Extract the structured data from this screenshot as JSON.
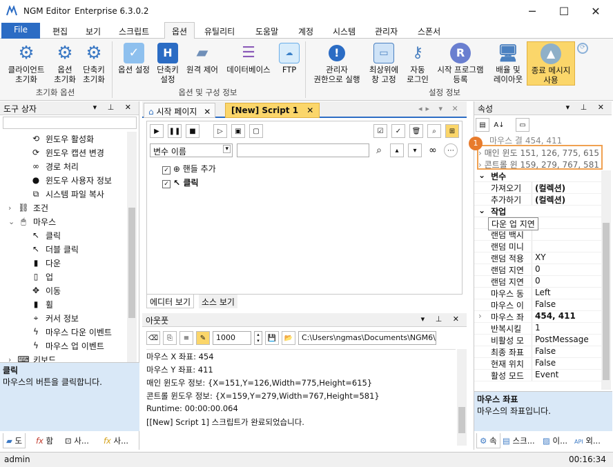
{
  "app": {
    "title": "NGM Editor",
    "version": "Enterprise 6.3.0.2"
  },
  "window_controls": {
    "minimize": "─",
    "maximize": "☐",
    "close": "✕"
  },
  "ribbon_tabs": [
    "File",
    "편집",
    "보기",
    "스크립트",
    "옵션",
    "유틸리티",
    "도움말",
    "계정",
    "시스템",
    "관리자",
    "스폰서"
  ],
  "ribbon_active_tab": "옵션",
  "ribbon": {
    "groups": [
      {
        "label": "초기화 옵션",
        "buttons": [
          {
            "label1": "클라이언트",
            "label2": "초기화",
            "icon": "gear-icon",
            "color": "#3a78c4"
          },
          {
            "label1": "옵션",
            "label2": "초기화",
            "icon": "gear-icon",
            "color": "#3a78c4"
          },
          {
            "label1": "단축키",
            "label2": "초기화",
            "icon": "gear-icon",
            "color": "#3a78c4"
          }
        ]
      },
      {
        "label": "옵션 및 구성 정보",
        "buttons": [
          {
            "label1": "옵션 설정",
            "label2": "",
            "icon": "checkbox-icon",
            "color": "#4a90d9"
          },
          {
            "label1": "단축키",
            "label2": "설정",
            "icon": "hotkey-icon",
            "color": "#2b6cc4"
          },
          {
            "label1": "원격 제어",
            "label2": "",
            "icon": "remote-icon",
            "color": "#6f8fb8"
          },
          {
            "label1": "데이터베이스",
            "label2": "",
            "icon": "database-icon",
            "color": "#8a5ab8"
          },
          {
            "label1": "FTP",
            "label2": "",
            "icon": "ftp-icon",
            "color": "#4aa0e0"
          }
        ]
      },
      {
        "label": "설정 정보",
        "buttons": [
          {
            "label1": "관리자",
            "label2": "권한으로 실행",
            "icon": "warning-icon",
            "color": "#2b6cc4"
          },
          {
            "label1": "최상위에",
            "label2": "창 고정",
            "icon": "window-icon",
            "color": "#4a80c0"
          },
          {
            "label1": "자동",
            "label2": "로그인",
            "icon": "key-icon",
            "color": "#4a80c0"
          },
          {
            "label1": "시작 프로그램",
            "label2": "등록",
            "icon": "r-icon",
            "color": "#6a7fd0"
          },
          {
            "label1": "배율 및",
            "label2": "레이아웃",
            "icon": "monitor-icon",
            "color": "#4a80c0"
          },
          {
            "label1": "종료 메시지",
            "label2": "사용",
            "icon": "message-icon",
            "color": "#4a80c0"
          }
        ]
      }
    ]
  },
  "toolbox": {
    "title": "도구 상자",
    "items": [
      {
        "label": "윈도우 활성화",
        "icon": "window-activate-icon",
        "glyph": "⟲",
        "indent": 2
      },
      {
        "label": "윈도우 캡션 변경",
        "icon": "caption-change-icon",
        "glyph": "⟳",
        "indent": 2
      },
      {
        "label": "경로 처리",
        "icon": "path-icon",
        "glyph": "∞",
        "indent": 2
      },
      {
        "label": "윈도우 사용자 정보",
        "icon": "user-icon",
        "glyph": "●",
        "indent": 2
      },
      {
        "label": "시스템 파일 복사",
        "icon": "copy-icon",
        "glyph": "⧉",
        "indent": 2
      },
      {
        "label": "조건",
        "icon": "condition-icon",
        "glyph": "⛓",
        "indent": 1,
        "expander": "›"
      },
      {
        "label": "마우스",
        "icon": "mouse-icon",
        "glyph": "🖱",
        "indent": 1,
        "expander": "⌄"
      },
      {
        "label": "클릭",
        "icon": "click-icon",
        "glyph": "↖",
        "indent": 2
      },
      {
        "label": "더블 클릭",
        "icon": "double-click-icon",
        "glyph": "↖",
        "indent": 2
      },
      {
        "label": "다운",
        "icon": "mouse-down-icon",
        "glyph": "▮",
        "indent": 2
      },
      {
        "label": "업",
        "icon": "mouse-up-icon",
        "glyph": "▯",
        "indent": 2
      },
      {
        "label": "이동",
        "icon": "move-icon",
        "glyph": "✥",
        "indent": 2
      },
      {
        "label": "휠",
        "icon": "wheel-icon",
        "glyph": "▮",
        "indent": 2
      },
      {
        "label": "커서 정보",
        "icon": "cursor-info-icon",
        "glyph": "⌖",
        "indent": 2
      },
      {
        "label": "마우스 다운 이벤트",
        "icon": "bolt-icon",
        "glyph": "ϟ",
        "indent": 2
      },
      {
        "label": "마우스 업 이벤트",
        "icon": "bolt-icon",
        "glyph": "ϟ",
        "indent": 2
      },
      {
        "label": "키보드",
        "icon": "keyboard-icon",
        "glyph": "⌨",
        "indent": 1,
        "expander": "›"
      }
    ],
    "desc_title": "클릭",
    "desc_text": "마우스의 버튼을 클릭합니다.",
    "bottom_tabs": [
      "도",
      "함",
      "사...",
      "사..."
    ]
  },
  "editor": {
    "tabs": [
      {
        "label": "시작 페이지"
      },
      {
        "label": "[New] Script 1"
      }
    ],
    "variable_select": "변수 이름",
    "variable_search": "",
    "script_lines": [
      {
        "label": "핸들 추가",
        "icon": "crosshair-icon",
        "glyph": "⊕"
      },
      {
        "label": "클릭",
        "icon": "click-icon",
        "glyph": "↖"
      }
    ],
    "view_tabs": [
      "에디터 보기",
      "소스 보기"
    ]
  },
  "output": {
    "title": "아웃풋",
    "interval": "1000",
    "path": "C:\\Users\\ngmas\\Documents\\NGM6\\",
    "lines": [
      "마우스 X 좌표: 454",
      "마우스 Y 좌표: 411",
      "매인 윈도우 정보: {X=151,Y=126,Width=775,Height=615}",
      "콘트롤 윈도우 정보: {X=159,Y=279,Width=767,Height=581}",
      "Runtime: 00:00:00.064",
      "[[New] Script 1] 스크립트가 완료되었습니다."
    ]
  },
  "properties": {
    "title": "속성",
    "top_row": {
      "key": "마우스 결",
      "val": "454, 411"
    },
    "highlighted": [
      {
        "key": "매인 윈도",
        "val": "151, 126, 775, 615"
      },
      {
        "key": "콘트롤 윈",
        "val": "159, 279, 767, 581"
      }
    ],
    "badge": "1",
    "sections": [
      {
        "title": "변수",
        "rows": [
          {
            "key": "가져오기",
            "val": "(컬렉션)",
            "bold": true
          },
          {
            "key": "추가하기",
            "val": "(컬렉션)",
            "bold": true
          }
        ]
      },
      {
        "title": "작업",
        "rows": [
          {
            "key": "다운 업 지연",
            "val": "",
            "tooltip": true
          },
          {
            "key": "랜덤 백시",
            "val": ""
          },
          {
            "key": "랜덤 미니",
            "val": ""
          },
          {
            "key": "랜덤 적용",
            "val": "XY"
          },
          {
            "key": "랜덤 지연",
            "val": "0"
          },
          {
            "key": "랜덤 지연",
            "val": "0"
          },
          {
            "key": "마우스 동",
            "val": "Left"
          },
          {
            "key": "마우스 이",
            "val": "False"
          },
          {
            "key": "마우스 좌",
            "val": "454, 411",
            "bold": true,
            "expander": true
          },
          {
            "key": "반복시킬",
            "val": "1"
          },
          {
            "key": "비활성 모",
            "val": "PostMessage"
          },
          {
            "key": "최종 좌표",
            "val": "False"
          },
          {
            "key": "현재 위치",
            "val": "False"
          },
          {
            "key": "활성 모드",
            "val": "Event"
          }
        ]
      }
    ],
    "desc_title": "마우스 좌표",
    "desc_text": "마우스의 좌표입니다.",
    "bottom_tabs": [
      "속",
      "스크...",
      "이...",
      "외..."
    ]
  },
  "status": {
    "user": "admin",
    "time": "00:16:34"
  },
  "colors": {
    "accent": "#2b6cc4",
    "highlight_border": "#f0a050",
    "badge": "#e87b2c",
    "yellow_btn": "#fbd66a"
  }
}
